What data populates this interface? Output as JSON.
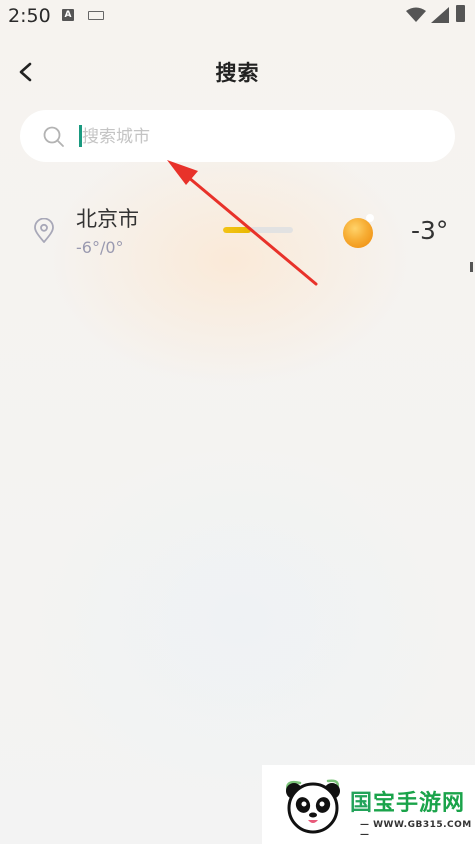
{
  "status_bar": {
    "time": "2:50",
    "icons": [
      "a-icon",
      "keyboard-icon",
      "wifi-icon",
      "signal-icon",
      "battery-icon"
    ]
  },
  "header": {
    "title": "搜索",
    "back_icon": "chevron-left-icon"
  },
  "search": {
    "placeholder": "搜索城市",
    "value": "",
    "icon": "search-icon"
  },
  "results": [
    {
      "city": "北京市",
      "range": "-6°/0°",
      "bar_fill_fraction": 0.4,
      "weather_icon": "sun-icon",
      "current_temp": "-3°"
    }
  ],
  "watermark": {
    "brand_first": "国",
    "brand_rest": "宝手游网",
    "url": "— WWW.GB315.COM —"
  },
  "colors": {
    "accent": "#1a9a80",
    "bar": "#f3c316",
    "sun": "#f5a623",
    "arrow": "#e8322a",
    "brand": "#1aa34a"
  }
}
